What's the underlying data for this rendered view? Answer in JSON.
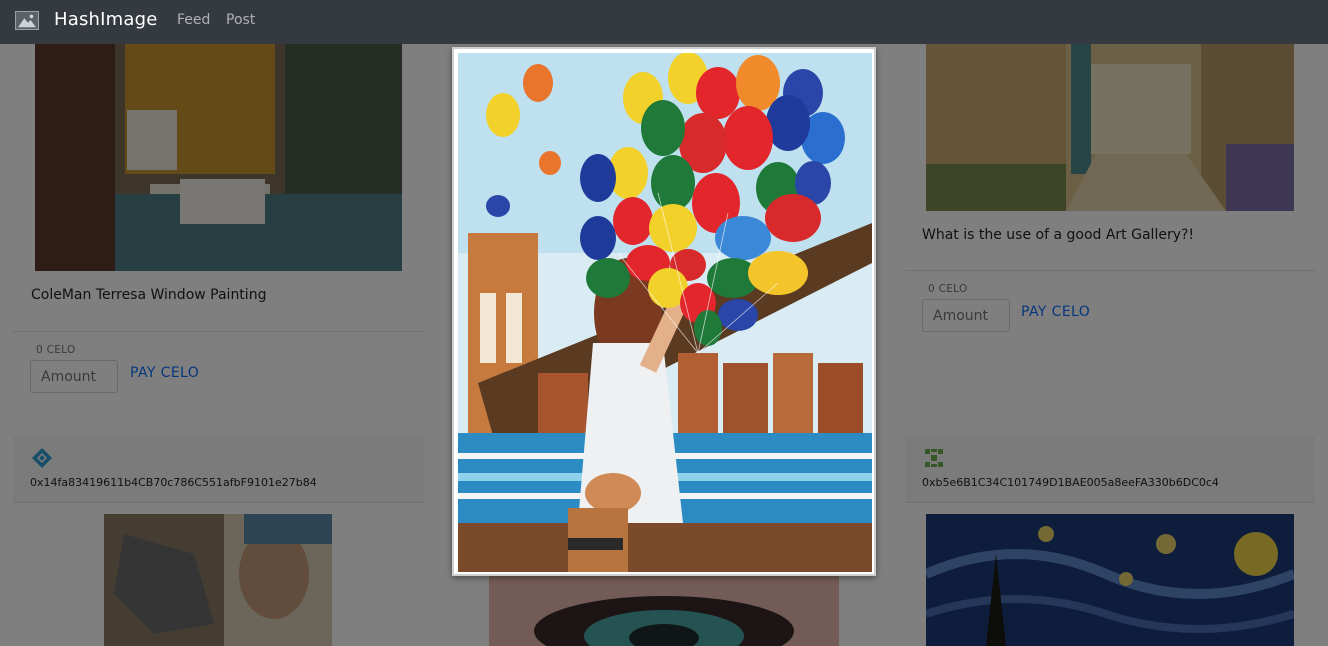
{
  "navbar": {
    "brand": "HashImage",
    "links": [
      "Feed",
      "Post"
    ]
  },
  "posts": [
    {
      "title": "ColeMan Terresa Window Painting",
      "price": "0 CELO",
      "amount_placeholder": "Amount",
      "pay_label": "PAY CELO"
    },
    {
      "title": "What is the use of a good Art Gallery?!",
      "price": "0 CELO",
      "amount_placeholder": "Amount",
      "pay_label": "PAY CELO"
    }
  ],
  "owners": [
    {
      "address": "0x14fa83419611b4CB70c786C551afbF9101e27b84"
    },
    {
      "address": "0xb5e6B1C34C101749D1BAE005a8eeFA330b6DC0c4"
    }
  ],
  "colors": {
    "navbar": "#343a40",
    "link": "#0d6efd",
    "overlay": "rgba(0,0,0,0.5)"
  }
}
